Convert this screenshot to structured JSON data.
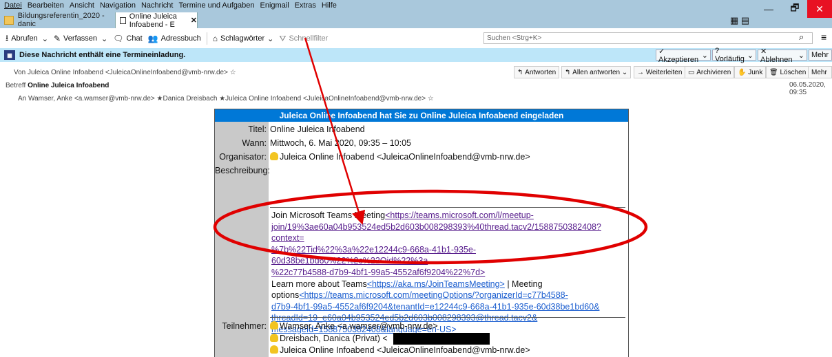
{
  "menubar": [
    "Datei",
    "Bearbeiten",
    "Ansicht",
    "Navigation",
    "Nachricht",
    "Termine und Aufgaben",
    "Enigmail",
    "Extras",
    "Hilfe"
  ],
  "tabs": [
    {
      "label": "Bildungsreferentin_2020 - danic"
    },
    {
      "label": "Online Juleica Infoabend - E",
      "close": "✕"
    }
  ],
  "window": {
    "minimize": "—",
    "maximize": "🗗",
    "close": "✕"
  },
  "toolbar": {
    "abrufen": "Abrufen",
    "verfassen": "Verfassen",
    "chat": "Chat",
    "adressbuch": "Adressbuch",
    "schlagwoerter": "Schlagwörter",
    "schnellfilter": "Schnellfilter",
    "search_placeholder": "Suchen <Strg+K>"
  },
  "eventbar": {
    "message": "Diese Nachricht enthält eine Termineinladung.",
    "accept": "✓ Akzeptieren",
    "tentative": "? Vorläufig",
    "decline": "✕ Ablehnen",
    "more": "Mehr"
  },
  "header": {
    "from_label": "Von",
    "from": "Juleica Online Infoabend <JuleicaOnlineInfoabend@vmb-nrw.de>",
    "subject_label": "Betreff",
    "subject": "Online Juleica Infoabend",
    "to_label": "An",
    "to": "Wamser, Anke <a.wamser@vmb-nrw.de> ★Danica Dreisbach ★Juleica Online Infoabend <JuleicaOnlineInfoabend@vmb-nrw.de>",
    "date": "06.05.2020, 09:35"
  },
  "actions": {
    "reply": "Antworten",
    "reply_all": "Allen antworten",
    "forward": "Weiterleiten",
    "archive": "Archivieren",
    "junk": "Junk",
    "delete": "Löschen",
    "more": "Mehr"
  },
  "invite": {
    "heading": "Juleica Online Infoabend hat Sie zu Online Juleica Infoabend eingeladen",
    "title_label": "Titel:",
    "title": "Online Juleica Infoabend",
    "when_label": "Wann:",
    "when": "Mittwoch, 6. Mai 2020, 09:35 – 10:05",
    "organizer_label": "Organisator:",
    "organizer": "Juleica Online Infoabend <JuleicaOnlineInfoabend@vmb-nrw.de>",
    "description_label": "Beschreibung:",
    "join_text": "Join Microsoft Teams Meeting",
    "join_link_1": "<https://teams.microsoft.com/l/meetup-",
    "join_link_2": "join/19%3ae60a04b953524ed5b2d603b008298393%40thread.tacv2/1588750382408?context=",
    "join_link_3": "%7b%22Tid%22%3a%22e12244c9-668a-41b1-935e-60d38be1bd60%22%2c%22Oid%22%3a",
    "join_link_4": "%22c77b4588-d7b9-4bf1-99a5-4552af6f9204%22%7d>",
    "learn_text": "Learn more about Teams",
    "learn_link": "<https://aka.ms/JoinTeamsMeeting>",
    "learn_sep": " | Meeting",
    "options_text": "options",
    "options_link_1": "<https://teams.microsoft.com/meetingOptions/?organizerId=c77b4588-",
    "options_link_2": "d7b9-4bf1-99a5-4552af6f9204&tenantId=e12244c9-668a-41b1-935e-60d38be1bd60&",
    "options_link_3": "threadId=19_e60a04b953524ed5b2d603b008298393@thread.tacv2&",
    "options_link_4": "messageId=1588750382408&language=en-US>",
    "attendees_label": "Teilnehmer:",
    "attendee_1": "Wamser, Anke <a.wamser@vmb-nrw.de>",
    "attendee_2": "Dreisbach, Danica (Privat) <",
    "attendee_3": "Juleica Online Infoabend <JuleicaOnlineInfoabend@vmb-nrw.de>"
  },
  "colors": {
    "annotation": "#e00000",
    "heading_bg": "#0078d7",
    "eventbar_bg": "#bde6f9"
  }
}
